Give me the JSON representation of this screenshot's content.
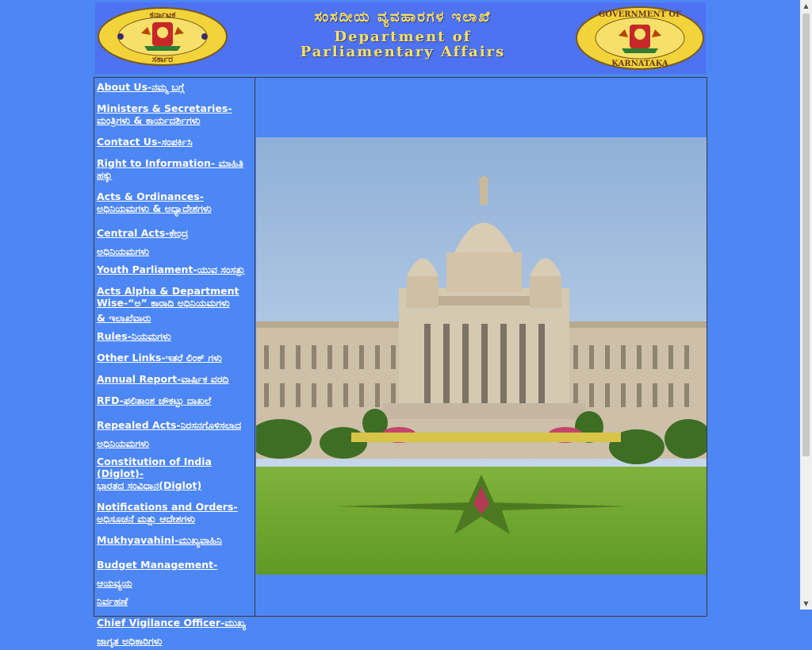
{
  "banner": {
    "kannada_title": "ಸಂಸದೀಯ ವ್ಯವಹಾರಗಳ ಇಲಾಖೆ",
    "english_line1": "Department of",
    "english_line2": "Parliamentary Affairs",
    "left_seal_top": "ಕರ್ನಾಟಕ",
    "left_seal_bottom": "ಸರ್ಕಾರ",
    "right_seal_top": "GOVERNMENT OF",
    "right_seal_bottom": "KARNATAKA"
  },
  "nav": [
    {
      "line1": "About Us-ನಮ್ಮ ಬಗ್ಗೆ"
    },
    {
      "line1": "Ministers & Secretaries-",
      "line2": "ಮಂತ್ರಿಗಳು & ಕಾರ್ಯದರ್ಶಿಗಳು"
    },
    {
      "line1": "Contact Us-ಸಂಪರ್ಕಿಸಿ"
    },
    {
      "line1": "Right to Information- ಮಾಹಿತಿ ಹಕ್ಕು"
    },
    {
      "line1": "Acts & Ordinances-",
      "line2": "ಅಧಿನಿಯಮಗಳು & ಅಧ್ಯಾದೇಶಗಳು"
    },
    {
      "line1": "Central Acts-ಕೇಂದ್ರ",
      "line2": "ಅಧಿನಿಯಮಗಳು"
    },
    {
      "line1": "Youth Parliament-ಯುವ ಸಂಸತ್ತು"
    },
    {
      "line1": "Acts Alpha & Department",
      "line2": "Wise-“ಅ” ಕಾರಾದಿ ಅಧಿನಿಯಮಗಳು",
      "line3": "& ಇಲಾಖೆವಾರು"
    },
    {
      "line1": "Rules-ನಿಯಮಗಳು"
    },
    {
      "line1": "Other Links-ಇತರೆ ಲಿಂಕ್ ಗಳು"
    },
    {
      "line1": "Annual Report-ವಾರ್ಷಿಕ ವರದಿ"
    },
    {
      "line1": "RFD-ಫಲಿತಾಂಶ ಚೌಕಟ್ಟು ದಾಖಲೆ"
    },
    {
      "line1": "Repealed Acts-ನಿರಸನಗೊಳಿಸಲಾದ",
      "line2": "ಅಧಿನಿಯಮಗಳು"
    },
    {
      "line1": "Constitution of India (Diglot)-",
      "line2": "ಭಾರತದ ಸಂವಿಧಾನ(Diglot)"
    },
    {
      "line1": "Notifications and Orders-",
      "line2": "ಅಧಿಸೂಚನೆ ಮತ್ತು ಆದೇಶಗಳು"
    },
    {
      "line1": "Mukhyavahini-ಮುಖ್ಯವಾಹಿನಿ"
    },
    {
      "line1": "Budget Management-ಆಯವ್ಯಯ",
      "line2": "ನಿರ್ವಹಣೆ"
    },
    {
      "line1": "Chief Vigilance Officer-ಮುಖ್ಯ",
      "line2": "ಜಾಗೃತ ಅಧಿಕಾರಿಗಳು"
    }
  ],
  "colors": {
    "page_background": "#4d86f5",
    "banner_background": "#4d72f2",
    "banner_text": "#f6e35a",
    "link": "#ffffff"
  }
}
